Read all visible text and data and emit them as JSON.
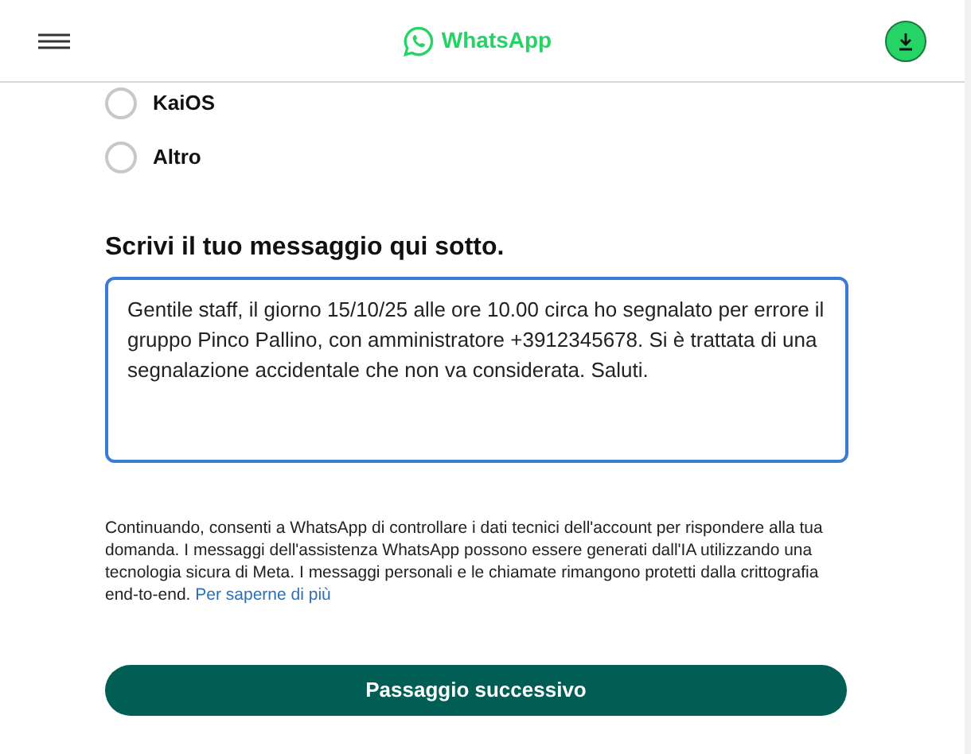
{
  "header": {
    "logo_text": "WhatsApp"
  },
  "options": [
    {
      "label": "KaiOS",
      "selected": false
    },
    {
      "label": "Altro",
      "selected": false
    }
  ],
  "message": {
    "heading": "Scrivi il tuo messaggio qui sotto.",
    "value": "Gentile staff, il giorno 15/10/25 alle ore 10.00 circa ho segnalato per errore il gruppo Pinco Pallino, con amministratore +3912345678. Si è trattata di una segnalazione accidentale che non va considerata. Saluti."
  },
  "disclaimer": {
    "text": "Continuando, consenti a WhatsApp di controllare i dati tecnici dell'account per rispondere alla tua domanda. I messaggi dell'assistenza WhatsApp possono essere generati dall'IA utilizzando una tecnologia sicura di Meta. I messaggi personali e le chiamate rimangono protetti dalla crittografia end-to-end.",
    "link": "Per saperne di più"
  },
  "next_button": "Passaggio successivo"
}
